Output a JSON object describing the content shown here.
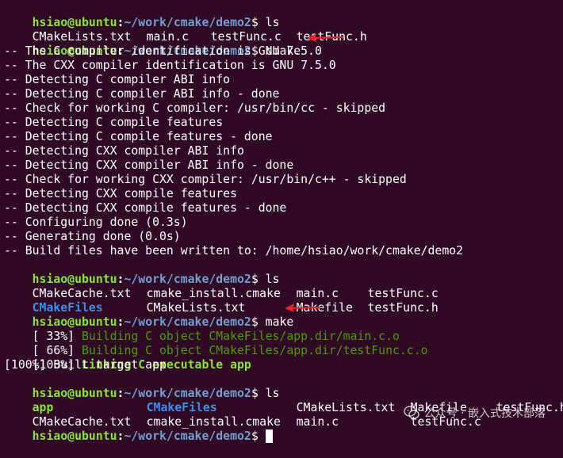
{
  "prompt": {
    "user_host": "hsiao@ubuntu",
    "colon": ":",
    "path": "~/work/cmake/demo2",
    "dollar": "$ "
  },
  "colors": {
    "background": "#300a24",
    "prompt_user": "#8ae234",
    "prompt_path": "#729fcf",
    "directory": "#3b8eea",
    "progress_green": "#4e9a06",
    "arrow_red": "#e8232a"
  },
  "lines": {
    "l1_cmd": "ls",
    "l2_files": [
      "CMakeLists.txt",
      "main.c",
      "testFunc.c",
      "testFunc.h"
    ],
    "l3_cmd": "cmake .",
    "cmake_output": [
      "-- The C compiler identification is GNU 7.5.0",
      "-- The CXX compiler identification is GNU 7.5.0",
      "-- Detecting C compiler ABI info",
      "-- Detecting C compiler ABI info - done",
      "-- Check for working C compiler: /usr/bin/cc - skipped",
      "-- Detecting C compile features",
      "-- Detecting C compile features - done",
      "-- Detecting CXX compiler ABI info",
      "-- Detecting CXX compiler ABI info - done",
      "-- Check for working CXX compiler: /usr/bin/c++ - skipped",
      "-- Detecting CXX compile features",
      "-- Detecting CXX compile features - done",
      "-- Configuring done (0.3s)",
      "-- Generating done (0.0s)",
      "-- Build files have been written to: /home/hsiao/work/cmake/demo2"
    ],
    "ls2_cmd": "ls",
    "ls2_row1": [
      "CMakeCache.txt",
      "cmake_install.cmake",
      "main.c",
      "testFunc.c"
    ],
    "ls2_row2": [
      "CMakeFiles",
      "CMakeLists.txt",
      "Makefile",
      "testFunc.h"
    ],
    "make_cmd": "make",
    "make_out": {
      "p1": "[ 33%] ",
      "p1_text": "Building C object CMakeFiles/app.dir/main.c.o",
      "p2": "[ 66%] ",
      "p2_text": "Building C object CMakeFiles/app.dir/testFunc.c.o",
      "p3": "[100%] ",
      "p3_text": "Linking C executable app",
      "p4": "[100%] Built target app"
    },
    "ls3_cmd": "ls",
    "ls3_row1": [
      "app",
      "CMakeFiles",
      "CMakeLists.txt",
      "Makefile",
      "testFunc.h"
    ],
    "ls3_row2": [
      "CMakeCache.txt",
      "cmake_install.cmake",
      "main.c",
      "testFunc.c"
    ]
  },
  "watermark": {
    "icon": "wechat-icon",
    "text": "公众号 · 嵌入式技术部落"
  }
}
